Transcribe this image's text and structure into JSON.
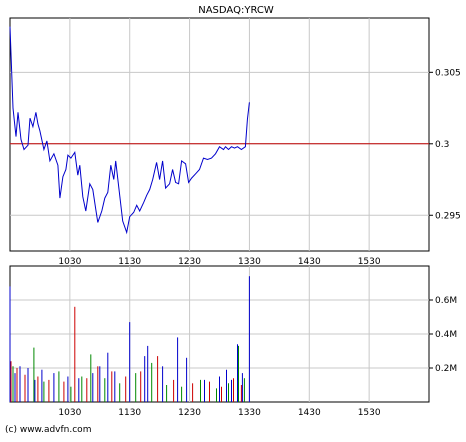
{
  "chart_data": [
    {
      "type": "line",
      "title": "NASDAQ:YRCW",
      "xlabel": "",
      "ylabel": "",
      "x_ticks": [
        "1030",
        "1130",
        "1230",
        "1330",
        "1430",
        "1530"
      ],
      "y_ticks": [
        "0.305",
        "0.3",
        "0.295"
      ],
      "ylim": [
        0.2925,
        0.3088
      ],
      "xlim": [
        "09:30",
        "16:30"
      ],
      "grid": true,
      "reference_line": {
        "value": 0.3,
        "color": "#c00000"
      },
      "line_color": "#0000cc",
      "x": [
        "09:30",
        "09:33",
        "09:36",
        "09:38",
        "09:41",
        "09:44",
        "09:48",
        "09:50",
        "09:53",
        "09:56",
        "09:58",
        "10:00",
        "10:04",
        "10:07",
        "10:10",
        "10:14",
        "10:18",
        "10:20",
        "10:23",
        "10:26",
        "10:28",
        "10:31",
        "10:35",
        "10:38",
        "10:40",
        "10:43",
        "10:46",
        "10:50",
        "10:53",
        "10:56",
        "10:58",
        "11:02",
        "11:05",
        "11:08",
        "11:11",
        "11:14",
        "11:16",
        "11:20",
        "11:23",
        "11:27",
        "11:30",
        "11:34",
        "11:37",
        "11:40",
        "11:44",
        "11:47",
        "11:50",
        "11:53",
        "11:57",
        "12:00",
        "12:03",
        "12:06",
        "12:10",
        "12:13",
        "12:16",
        "12:19",
        "12:22",
        "12:26",
        "12:29",
        "12:32",
        "12:36",
        "12:40",
        "12:44",
        "12:48",
        "12:52",
        "12:56",
        "13:00",
        "13:04",
        "13:06",
        "13:09",
        "13:12",
        "13:15",
        "13:18",
        "13:22",
        "13:26",
        "13:28",
        "13:30"
      ],
      "y": [
        0.3082,
        0.3025,
        0.3005,
        0.3022,
        0.3003,
        0.2996,
        0.2999,
        0.3018,
        0.3012,
        0.3022,
        0.3014,
        0.3009,
        0.2996,
        0.3002,
        0.2988,
        0.2993,
        0.2985,
        0.2962,
        0.2977,
        0.2982,
        0.2992,
        0.299,
        0.2994,
        0.2978,
        0.2985,
        0.2963,
        0.2953,
        0.2972,
        0.2968,
        0.2954,
        0.2945,
        0.2953,
        0.2962,
        0.2966,
        0.2985,
        0.2975,
        0.2988,
        0.2964,
        0.2946,
        0.2938,
        0.2949,
        0.2952,
        0.2957,
        0.2953,
        0.2959,
        0.2964,
        0.2968,
        0.2975,
        0.2987,
        0.2975,
        0.2988,
        0.2969,
        0.2972,
        0.2982,
        0.2973,
        0.2972,
        0.2988,
        0.2986,
        0.2973,
        0.2976,
        0.2979,
        0.2982,
        0.299,
        0.2989,
        0.299,
        0.2993,
        0.2998,
        0.2996,
        0.2998,
        0.2996,
        0.2998,
        0.2997,
        0.2998,
        0.2996,
        0.2998,
        0.3017,
        0.3029
      ]
    },
    {
      "type": "bar",
      "title": "",
      "xlabel": "",
      "ylabel": "",
      "x_ticks": [
        "1030",
        "1130",
        "1230",
        "1330",
        "1430",
        "1530"
      ],
      "y_ticks": [
        "0.6M",
        "0.4M",
        "0.2M"
      ],
      "ylim": [
        0,
        800000
      ],
      "xlim": [
        "09:30",
        "16:30"
      ],
      "grid": true,
      "series_colors": {
        "up": "#008800",
        "down": "#cc0000",
        "unchanged": "#0000cc"
      },
      "series": [
        {
          "name": "",
          "color": "up",
          "x": [
            "09:33",
            "09:54",
            "10:04",
            "10:19",
            "10:31",
            "10:42",
            "10:51",
            "11:05",
            "11:20",
            "11:36",
            "11:52",
            "12:07",
            "12:22",
            "12:41",
            "12:57",
            "13:09",
            "13:19",
            "13:25"
          ],
          "values": [
            210000,
            320000,
            120000,
            180000,
            90000,
            150000,
            280000,
            140000,
            110000,
            170000,
            230000,
            100000,
            90000,
            130000,
            80000,
            110000,
            330000,
            140000
          ]
        },
        {
          "name": "",
          "color": "down",
          "x": [
            "09:31",
            "09:37",
            "09:45",
            "09:58",
            "10:09",
            "10:24",
            "10:35",
            "10:47",
            "10:58",
            "11:12",
            "11:26",
            "11:41",
            "11:58",
            "12:14",
            "12:33",
            "12:50",
            "13:02",
            "13:14",
            "13:22"
          ],
          "values": [
            240000,
            200000,
            160000,
            150000,
            130000,
            120000,
            560000,
            140000,
            210000,
            180000,
            150000,
            180000,
            270000,
            130000,
            110000,
            120000,
            90000,
            140000,
            100000
          ]
        },
        {
          "name": "",
          "color": "unchanged",
          "x": [
            "09:30",
            "09:35",
            "09:40",
            "09:48",
            "09:55",
            "10:02",
            "10:14",
            "10:28",
            "10:39",
            "10:53",
            "11:00",
            "11:08",
            "11:15",
            "11:30",
            "11:45",
            "11:48",
            "12:03",
            "12:18",
            "12:27",
            "12:45",
            "13:00",
            "13:07",
            "13:12",
            "13:18",
            "13:23",
            "13:30"
          ],
          "values": [
            680000,
            170000,
            210000,
            200000,
            130000,
            190000,
            170000,
            150000,
            140000,
            170000,
            210000,
            290000,
            180000,
            470000,
            270000,
            330000,
            210000,
            380000,
            260000,
            130000,
            150000,
            190000,
            130000,
            340000,
            170000,
            740000
          ]
        }
      ]
    }
  ],
  "footer": "(c) www.advfn.com"
}
